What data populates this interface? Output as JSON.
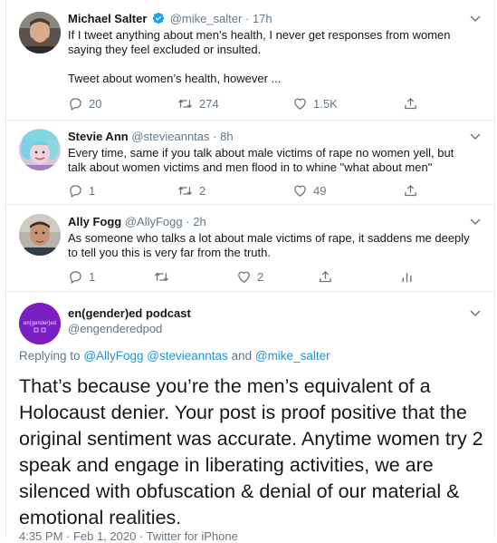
{
  "tweets": [
    {
      "name": "Michael Salter",
      "handle": "@mike_salter",
      "dot": "·",
      "time": "17h",
      "text_line1": "If I tweet anything about men’s health, I never get responses from women",
      "text_line2": "saying they feel excluded or insulted.",
      "text_line3": "Tweet about women’s health, however ...",
      "replies": "20",
      "retweets": "274",
      "likes": "1.5K",
      "verified": true
    },
    {
      "name": "Stevie Ann",
      "handle": "@stevieanntas",
      "dot": "·",
      "time": "8h",
      "text_line1": "Every time, same if you talk about male victims of rape no women yell, but",
      "text_line2": "talk about women victims and men flood in to whine \"what about men\"",
      "replies": "1",
      "retweets": "2",
      "likes": "49"
    },
    {
      "name": "Ally Fogg",
      "handle": "@AllyFogg",
      "dot": "·",
      "time": "2h",
      "text_line1": "As someone who talks a lot about male victims of rape, it saddens me deeply",
      "text_line2": "to tell you this is very far from the truth.",
      "replies": "1",
      "likes": "2"
    }
  ],
  "main_tweet": {
    "name": "en(gender)ed podcast",
    "handle": "@engenderedpod",
    "avatar_text": "en(gender)ed",
    "reply_prefix": "Replying to",
    "reply_users": "@AllyFogg @stevieanntas",
    "reply_and": "and",
    "reply_last": "@mike_salter",
    "text_lines": [
      "That’s because you’re the men’s equivalent of a",
      "Holocaust denier. Your post is proof positive that the",
      "original sentiment was accurate. Anytime women try 2",
      "speak and engage in liberating activities, we are",
      "silenced with obfuscation & denial of our material &",
      "emotional realities."
    ],
    "footer": "4:35 PM · Feb 1, 2020 · Twitter for iPhone"
  },
  "colors": {
    "link": "#1b95e0",
    "verified": "#1da1f2",
    "muted": "#657786",
    "avatar_purple": "#7b1fc4"
  },
  "icons": [
    "chevron-down-icon",
    "reply-icon",
    "retweet-icon",
    "like-icon",
    "share-icon",
    "analytics-icon",
    "verified-icon"
  ]
}
